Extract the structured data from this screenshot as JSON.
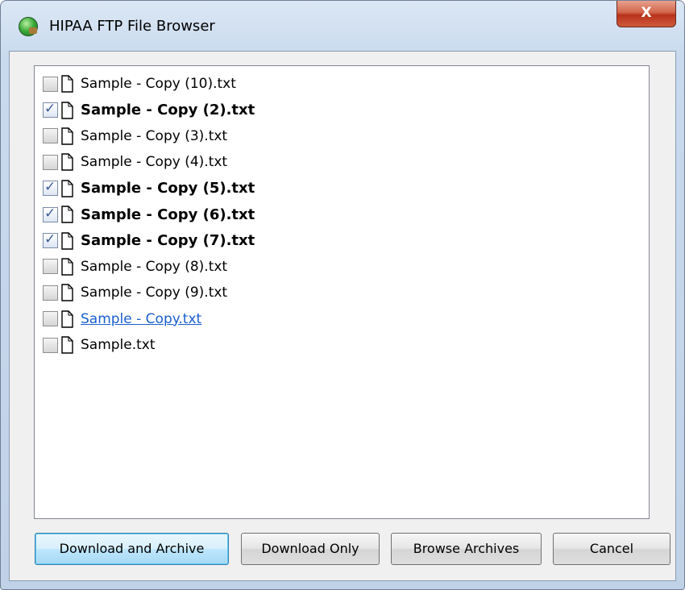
{
  "window": {
    "title": "HIPAA FTP File Browser",
    "close_label": "X"
  },
  "files": [
    {
      "name": "Sample - Copy (10).txt",
      "checked": false,
      "style": "normal"
    },
    {
      "name": "Sample - Copy (2).txt",
      "checked": true,
      "style": "bold"
    },
    {
      "name": "Sample - Copy (3).txt",
      "checked": false,
      "style": "normal"
    },
    {
      "name": "Sample - Copy (4).txt",
      "checked": false,
      "style": "normal"
    },
    {
      "name": "Sample - Copy (5).txt",
      "checked": true,
      "style": "bold"
    },
    {
      "name": "Sample - Copy (6).txt",
      "checked": true,
      "style": "bold"
    },
    {
      "name": "Sample - Copy (7).txt",
      "checked": true,
      "style": "bold"
    },
    {
      "name": "Sample - Copy (8).txt",
      "checked": false,
      "style": "normal"
    },
    {
      "name": "Sample - Copy (9).txt",
      "checked": false,
      "style": "normal"
    },
    {
      "name": "Sample - Copy.txt",
      "checked": false,
      "style": "link"
    },
    {
      "name": "Sample.txt",
      "checked": false,
      "style": "normal"
    }
  ],
  "buttons": {
    "download_archive": "Download and Archive",
    "download_only": "Download Only",
    "browse_archives": "Browse Archives",
    "cancel": "Cancel"
  },
  "colors": {
    "link": "#1a5fcf",
    "check": "#3d5b9a",
    "close": "#c7452a"
  }
}
